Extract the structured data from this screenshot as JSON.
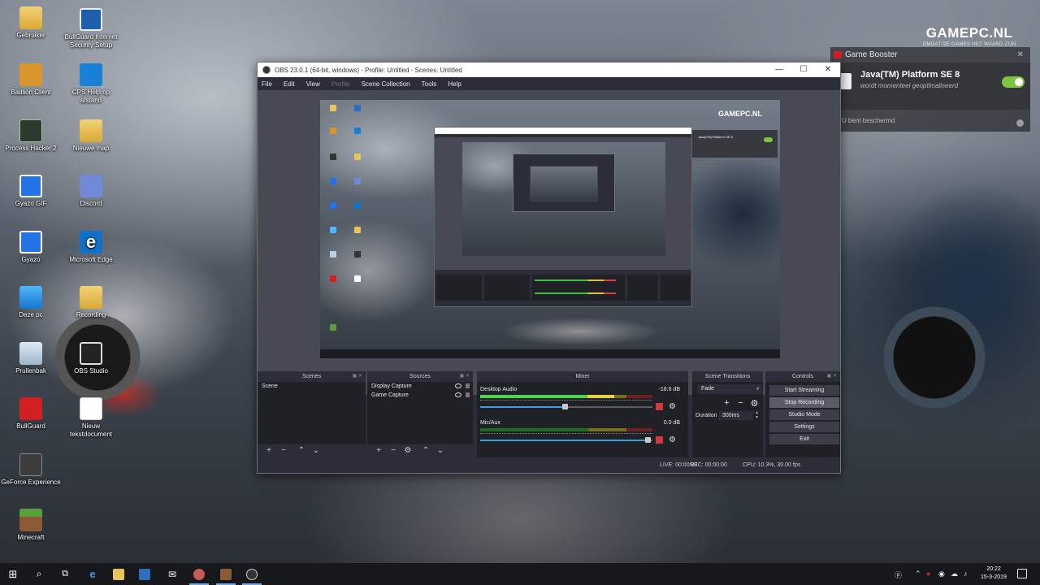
{
  "desktop": {
    "brand": {
      "name": "GAMEPC.NL",
      "tagline": "OMDAT DE GAMES HET WAARD ZIJN"
    },
    "icons": [
      {
        "label": "Gebruiker"
      },
      {
        "label": "BullGuard Internet Security Setup"
      },
      {
        "label": "Badlion Client"
      },
      {
        "label": "CPS Help op afstand"
      },
      {
        "label": "Process Hacker 2"
      },
      {
        "label": "Nieuwe map"
      },
      {
        "label": "Gyazo GIF"
      },
      {
        "label": "Discord"
      },
      {
        "label": "Gyazo"
      },
      {
        "label": "Microsoft Edge"
      },
      {
        "label": "Deze pc"
      },
      {
        "label": "Recording"
      },
      {
        "label": "Prullenbak"
      },
      {
        "label": "OBS Studio"
      },
      {
        "label": "BullGuard"
      },
      {
        "label": "Nieuw tekstdocument"
      },
      {
        "label": "GeForce Experience"
      },
      {
        "label": "Minecraft"
      }
    ]
  },
  "booster": {
    "title": "Game Booster",
    "app_name": "Java(TM) Platform SE 8",
    "app_status": "wordt momenteel geoptimaliseerd",
    "footer": "U bent beschermd",
    "toggle_on": true,
    "accent": "#7ec33c"
  },
  "obs": {
    "title": "OBS 23.0.1 (64-bit, windows) - Profile: Untitled - Scenes: Untitled",
    "menu": [
      "File",
      "Edit",
      "View",
      "Profile",
      "Scene Collection",
      "Tools",
      "Help"
    ],
    "preview_overlay": {
      "brand": "GAMEPC.NL",
      "app": "Java(TM) Platform SE 8"
    },
    "docks": {
      "scenes": {
        "title": "Scenes",
        "items": [
          "Scene"
        ]
      },
      "sources": {
        "title": "Sources",
        "items": [
          "Display Capture",
          "Game Capture"
        ]
      },
      "mixer": {
        "title": "Mixer",
        "channels": [
          {
            "name": "Desktop Audio",
            "db": "-18.6 dB",
            "level": 0.78,
            "volume": 0.49
          },
          {
            "name": "Mic/Aux",
            "db": "0.0 dB",
            "level": 0.0,
            "volume": 0.97
          }
        ]
      },
      "transitions": {
        "title": "Scene Transitions",
        "selected": "Fade",
        "duration_label": "Duration",
        "duration": "300ms"
      },
      "controls": {
        "title": "Controls",
        "buttons": [
          "Start Streaming",
          "Stop Recording",
          "Studio Mode",
          "Settings",
          "Exit"
        ],
        "active_index": 1
      }
    },
    "status": {
      "live": "LIVE: 00:00:00",
      "rec": "REC: 00:00:00",
      "cpu": "CPU: 10.3%, 30.00 fps"
    }
  },
  "taskbar": {
    "time": "20:22",
    "date": "15-3-2019"
  }
}
